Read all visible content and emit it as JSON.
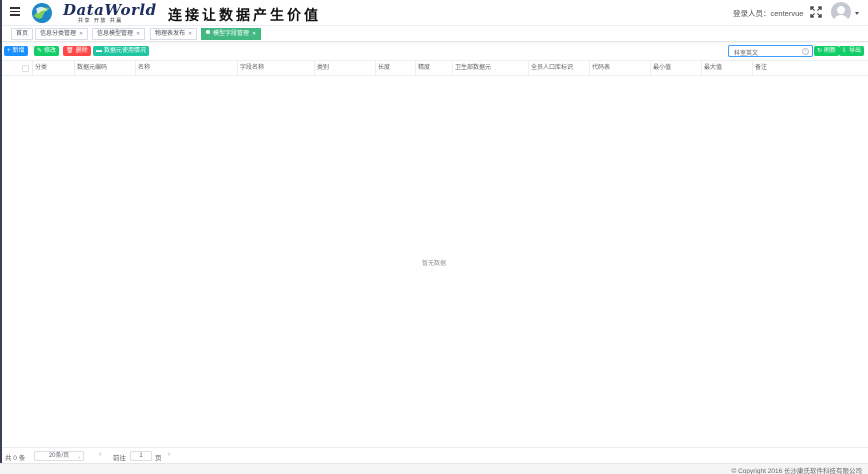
{
  "header": {
    "brand": "DataWorld",
    "brand_sub": "共享 开放 共赢",
    "slogan": "连接让数据产生价值",
    "login_label": "登录人员：centervue"
  },
  "tags": [
    {
      "label": "首页",
      "active": false
    },
    {
      "label": "信息分类管理",
      "active": false
    },
    {
      "label": "信息模型管理",
      "active": false
    },
    {
      "label": "物理表发布",
      "active": false
    },
    {
      "label": "模型字段管理",
      "active": true
    }
  ],
  "toolbar": {
    "add": "新增",
    "edit": "修改",
    "delete": "删除",
    "usage": "数据元使用情况",
    "search_value": "科室英文",
    "refresh": "刷新",
    "export": "导出"
  },
  "table": {
    "columns": [
      "分类",
      "数据元编码",
      "名称",
      "字段名称",
      "类别",
      "长度",
      "精度",
      "卫生部数据元",
      "全员人口库标识",
      "代码表",
      "最小值",
      "最大值",
      "备注"
    ],
    "empty_text": "暂无数据"
  },
  "pagination": {
    "total": "共 0 条",
    "page_size": "20条/页",
    "goto": "前往",
    "page": "1",
    "page_unit": "页"
  },
  "footer": {
    "copyright": "© Copyright 2016 长沙康氏软件科技有限公司"
  },
  "colors": {
    "primary": "#1890ff",
    "success": "#13ce66",
    "danger": "#ff4949",
    "active_tag": "#42b983"
  }
}
